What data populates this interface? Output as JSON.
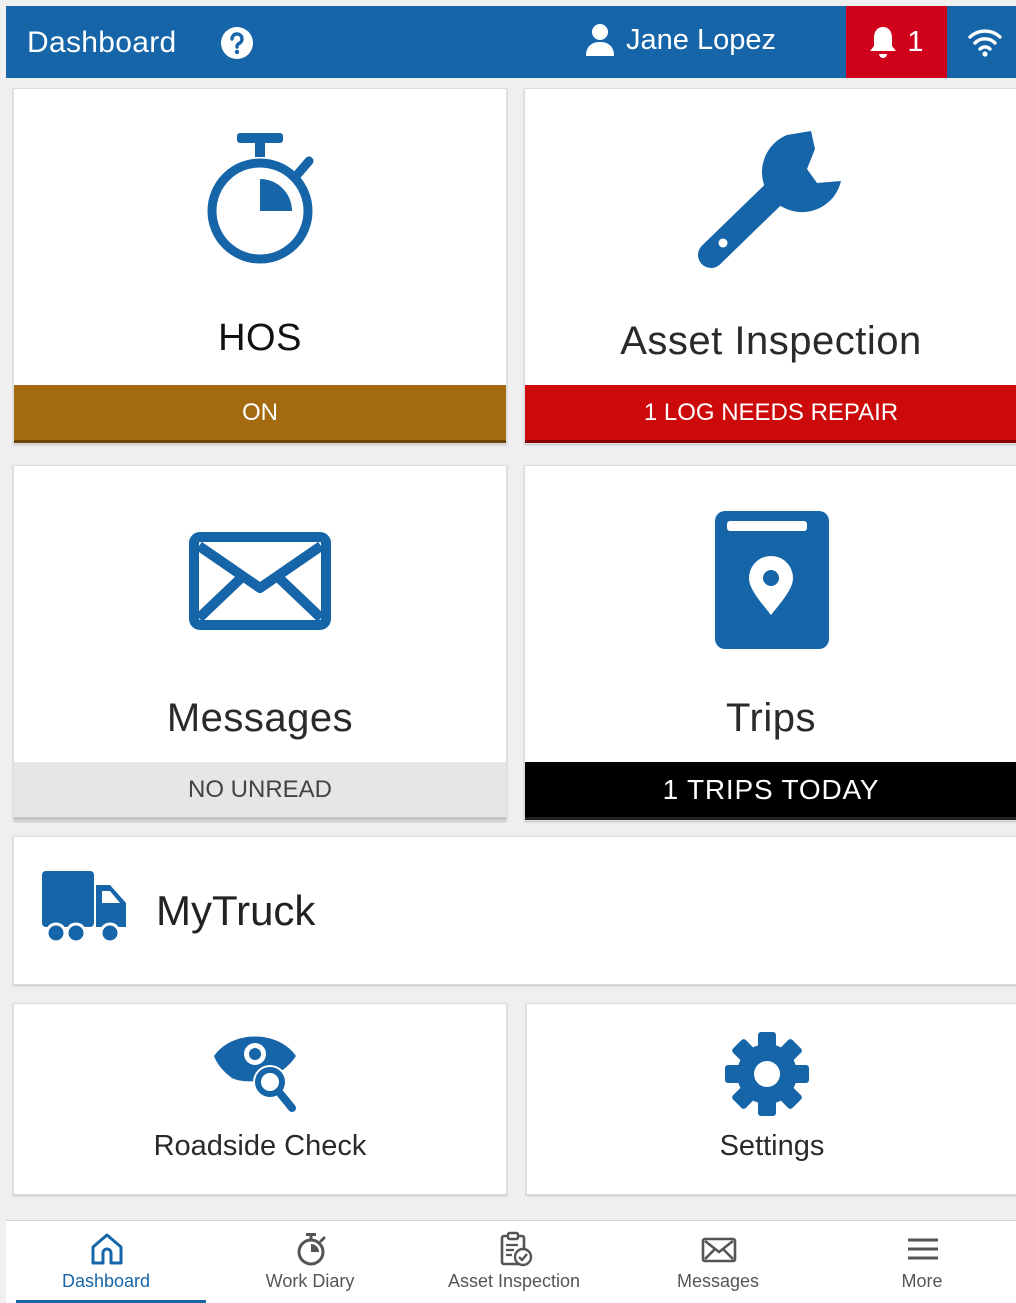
{
  "header": {
    "title": "Dashboard",
    "help_icon": "help-circle-icon",
    "user_name": "Jane Lopez",
    "notification_count": "1",
    "colors": {
      "bar": "#1565a8",
      "alert": "#d0021b"
    }
  },
  "tiles": {
    "hos": {
      "label": "HOS",
      "status": "ON",
      "icon": "stopwatch-icon",
      "status_color": "#a46a10"
    },
    "asset_inspection": {
      "label": "Asset Inspection",
      "status": "1 LOG NEEDS REPAIR",
      "icon": "wrench-icon",
      "status_color": "#cc0a0a"
    },
    "messages": {
      "label": "Messages",
      "status": "NO UNREAD",
      "icon": "envelope-icon",
      "status_color": "#e6e6e6"
    },
    "trips": {
      "label": "Trips",
      "status": "1 TRIPS TODAY",
      "icon": "map-book-icon",
      "status_color": "#000000"
    },
    "mytruck": {
      "label": "MyTruck",
      "icon": "truck-icon"
    },
    "roadside_check": {
      "label": "Roadside Check",
      "icon": "eye-search-icon"
    },
    "settings": {
      "label": "Settings",
      "icon": "gear-icon"
    }
  },
  "bottom_nav": {
    "items": [
      {
        "label": "Dashboard",
        "icon": "home-icon",
        "active": true
      },
      {
        "label": "Work Diary",
        "icon": "stopwatch-icon",
        "active": false
      },
      {
        "label": "Asset Inspection",
        "icon": "clipboard-check-icon",
        "active": false
      },
      {
        "label": "Messages",
        "icon": "envelope-icon",
        "active": false
      },
      {
        "label": "More",
        "icon": "menu-icon",
        "active": false
      }
    ]
  },
  "accent_color": "#1565a8"
}
